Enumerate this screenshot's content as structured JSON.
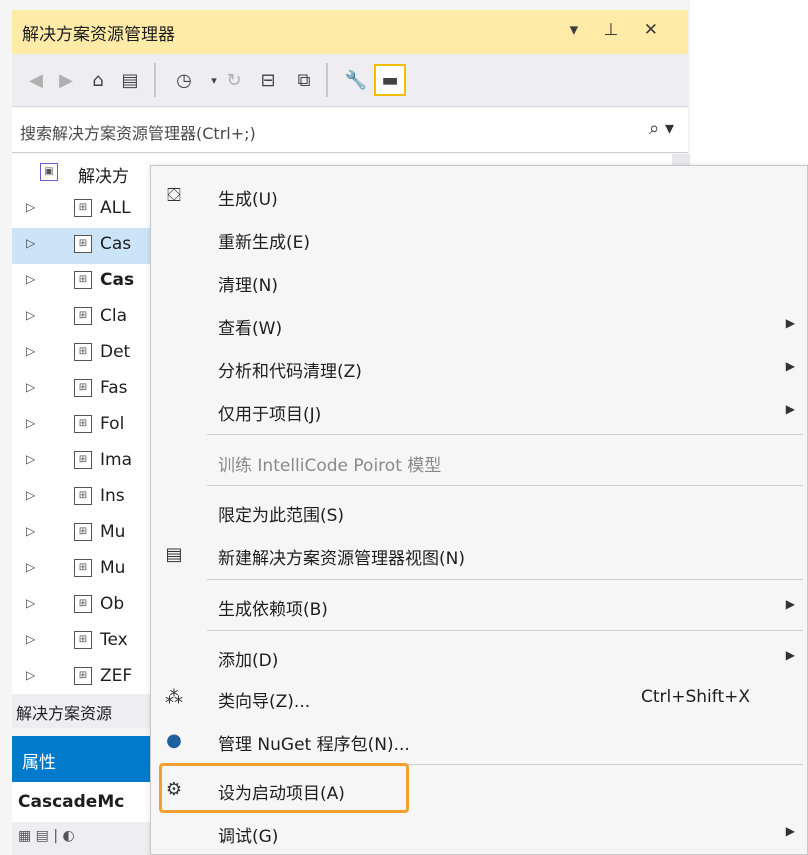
{
  "explorer": {
    "title": "解决方案资源管理器",
    "title_buttons": "▾ ⊥ ✕",
    "search_placeholder": "搜索解决方案资源管理器(Ctrl+;)",
    "tree": [
      {
        "label": "解决方"
      },
      {
        "label": "ALL"
      },
      {
        "label": "Cas"
      },
      {
        "label": "Cas"
      },
      {
        "label": "Cla"
      },
      {
        "label": "Det"
      },
      {
        "label": "Fas"
      },
      {
        "label": "Fol"
      },
      {
        "label": "Ima"
      },
      {
        "label": "Ins"
      },
      {
        "label": "Mu"
      },
      {
        "label": "Mu"
      },
      {
        "label": "Ob"
      },
      {
        "label": "Tex"
      },
      {
        "label": "ZEF"
      }
    ],
    "status": "解决方案资源",
    "properties_title": "属性",
    "properties_name": "CascadeMc"
  },
  "menu": {
    "items": [
      {
        "label": "生成(U)",
        "icon": "build-icon"
      },
      {
        "label": "重新生成(E)"
      },
      {
        "label": "清理(N)"
      },
      {
        "label": "查看(W)",
        "submenu": true
      },
      {
        "label": "分析和代码清理(Z)",
        "submenu": true
      },
      {
        "label": "仅用于项目(J)",
        "submenu": true
      },
      {
        "label": "训练 IntelliCode Poirot 模型",
        "disabled": true
      },
      {
        "label": "限定为此范围(S)"
      },
      {
        "label": "新建解决方案资源管理器视图(N)",
        "icon": "new-view-icon"
      },
      {
        "label": "生成依赖项(B)",
        "submenu": true
      },
      {
        "label": "添加(D)",
        "submenu": true
      },
      {
        "label": "类向导(Z)...",
        "shortcut": "Ctrl+Shift+X",
        "icon": "class-wizard-icon"
      },
      {
        "label": "管理 NuGet 程序包(N)...",
        "icon": "nuget-icon"
      },
      {
        "label": "设为启动项目(A)",
        "icon": "gear-icon",
        "highlighted": true
      },
      {
        "label": "调试(G)",
        "submenu": true
      }
    ]
  },
  "colors": {
    "highlight_border": "#f0a030",
    "accent": "#007acc",
    "selection": "#cce4f7",
    "title_bar": "#ffeba8"
  }
}
